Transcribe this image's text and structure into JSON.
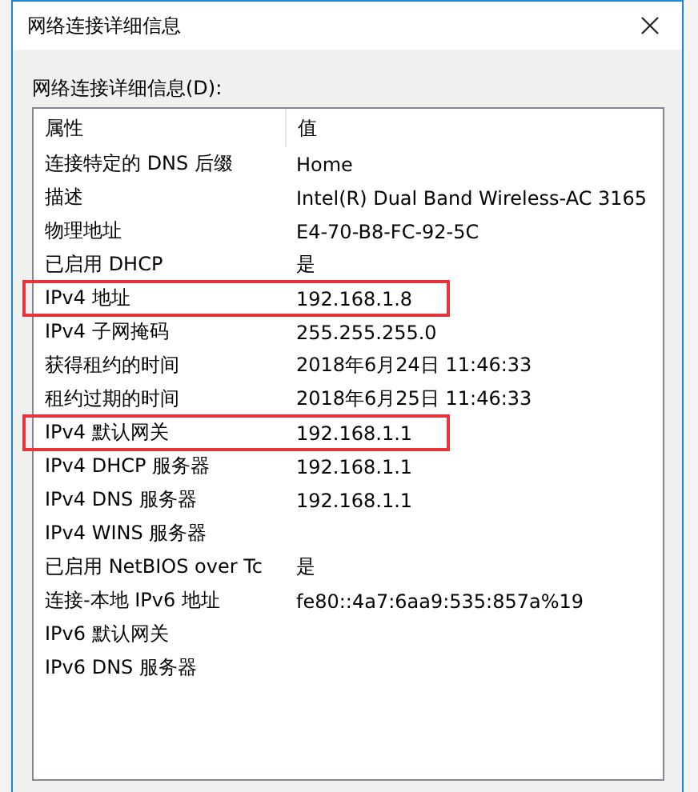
{
  "window": {
    "title": "网络连接详细信息"
  },
  "list_label": "网络连接详细信息(D):",
  "table": {
    "columns": [
      "属性",
      "值"
    ],
    "rows": [
      {
        "property": "连接特定的 DNS 后缀",
        "value": "Home",
        "highlighted": false
      },
      {
        "property": "描述",
        "value": "Intel(R) Dual Band Wireless-AC 3165",
        "highlighted": false
      },
      {
        "property": "物理地址",
        "value": "E4-70-B8-FC-92-5C",
        "highlighted": false
      },
      {
        "property": "已启用 DHCP",
        "value": "是",
        "highlighted": false
      },
      {
        "property": "IPv4 地址",
        "value": "192.168.1.8",
        "highlighted": true
      },
      {
        "property": "IPv4 子网掩码",
        "value": "255.255.255.0",
        "highlighted": false
      },
      {
        "property": "获得租约的时间",
        "value": "2018年6月24日 11:46:33",
        "highlighted": false
      },
      {
        "property": "租约过期的时间",
        "value": "2018年6月25日 11:46:33",
        "highlighted": false
      },
      {
        "property": "IPv4 默认网关",
        "value": "192.168.1.1",
        "highlighted": true
      },
      {
        "property": "IPv4 DHCP 服务器",
        "value": "192.168.1.1",
        "highlighted": false
      },
      {
        "property": "IPv4 DNS 服务器",
        "value": "192.168.1.1",
        "highlighted": false
      },
      {
        "property": "IPv4 WINS 服务器",
        "highlighted": false
      },
      {
        "property": "已启用 NetBIOS over Tc",
        "value": "是",
        "highlighted": false
      },
      {
        "property": "连接-本地 IPv6 地址",
        "value": "fe80::4a7:6aa9:535:857a%19",
        "highlighted": false
      },
      {
        "property": "IPv6 默认网关",
        "highlighted": false
      },
      {
        "property": "IPv6 DNS 服务器",
        "highlighted": false
      }
    ]
  }
}
